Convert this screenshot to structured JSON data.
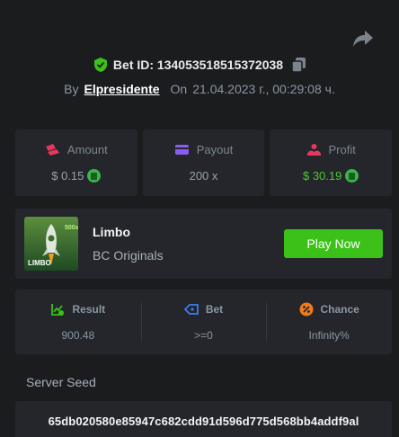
{
  "bet": {
    "id_label": "Bet ID: 134053518515372038",
    "by_label": "By",
    "user": "Elpresidente",
    "on_label": "On",
    "datetime": "21.04.2023 г., 00:29:08 ч."
  },
  "stats": {
    "amount_label": "Amount",
    "amount_value": "$ 0.15",
    "payout_label": "Payout",
    "payout_value": "200 x",
    "profit_label": "Profit",
    "profit_value": "$ 30.19"
  },
  "game": {
    "name": "Limbo",
    "provider": "BC Originals",
    "thumb_text": "LIMBO",
    "thumb_badge": "500x",
    "play_label": "Play Now"
  },
  "result": {
    "result_label": "Result",
    "result_value": "900.48",
    "bet_label": "Bet",
    "bet_value": ">=0",
    "chance_label": "Chance",
    "chance_value": "Infinity%"
  },
  "seed": {
    "label": "Server Seed",
    "value": "65db020580e85947c682cdd91d596d775d568bb4addf9al"
  },
  "colors": {
    "background": "#1b1c1e",
    "card": "#24262b",
    "accent_green": "#3bc117",
    "profit_green": "#4ec836"
  }
}
